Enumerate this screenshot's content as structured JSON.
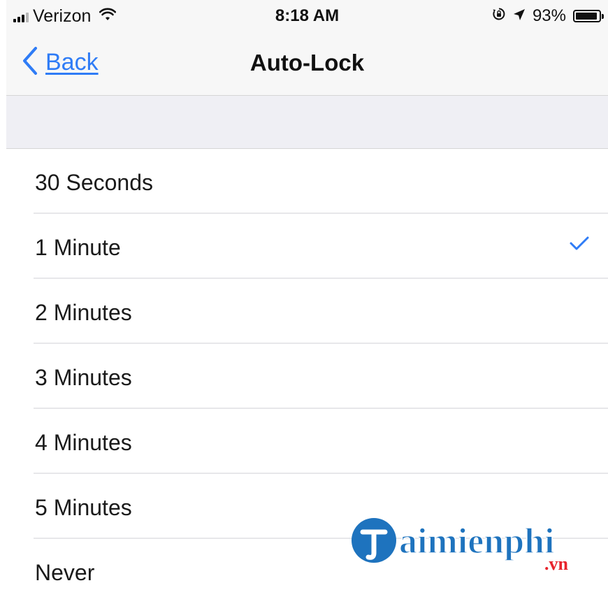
{
  "status_bar": {
    "carrier": "Verizon",
    "time": "8:18 AM",
    "battery_percent": "93%",
    "battery_level": 0.93,
    "icons": [
      "signal-icon",
      "wifi-icon",
      "screen-rotation-lock-icon",
      "location-arrow-icon",
      "battery-icon"
    ]
  },
  "nav": {
    "back_label": "Back",
    "title": "Auto-Lock"
  },
  "options": [
    {
      "label": "30 Seconds",
      "selected": false
    },
    {
      "label": "1 Minute",
      "selected": true
    },
    {
      "label": "2 Minutes",
      "selected": false
    },
    {
      "label": "3 Minutes",
      "selected": false
    },
    {
      "label": "4 Minutes",
      "selected": false
    },
    {
      "label": "5 Minutes",
      "selected": false
    },
    {
      "label": "Never",
      "selected": false
    }
  ],
  "colors": {
    "accent": "#2f7cf6",
    "bar_background": "#f7f7f7",
    "group_background": "#efeff4",
    "separator": "#e7e7ea"
  },
  "watermark": {
    "brand_name": "aimienphi",
    "suffix": ".vn"
  }
}
